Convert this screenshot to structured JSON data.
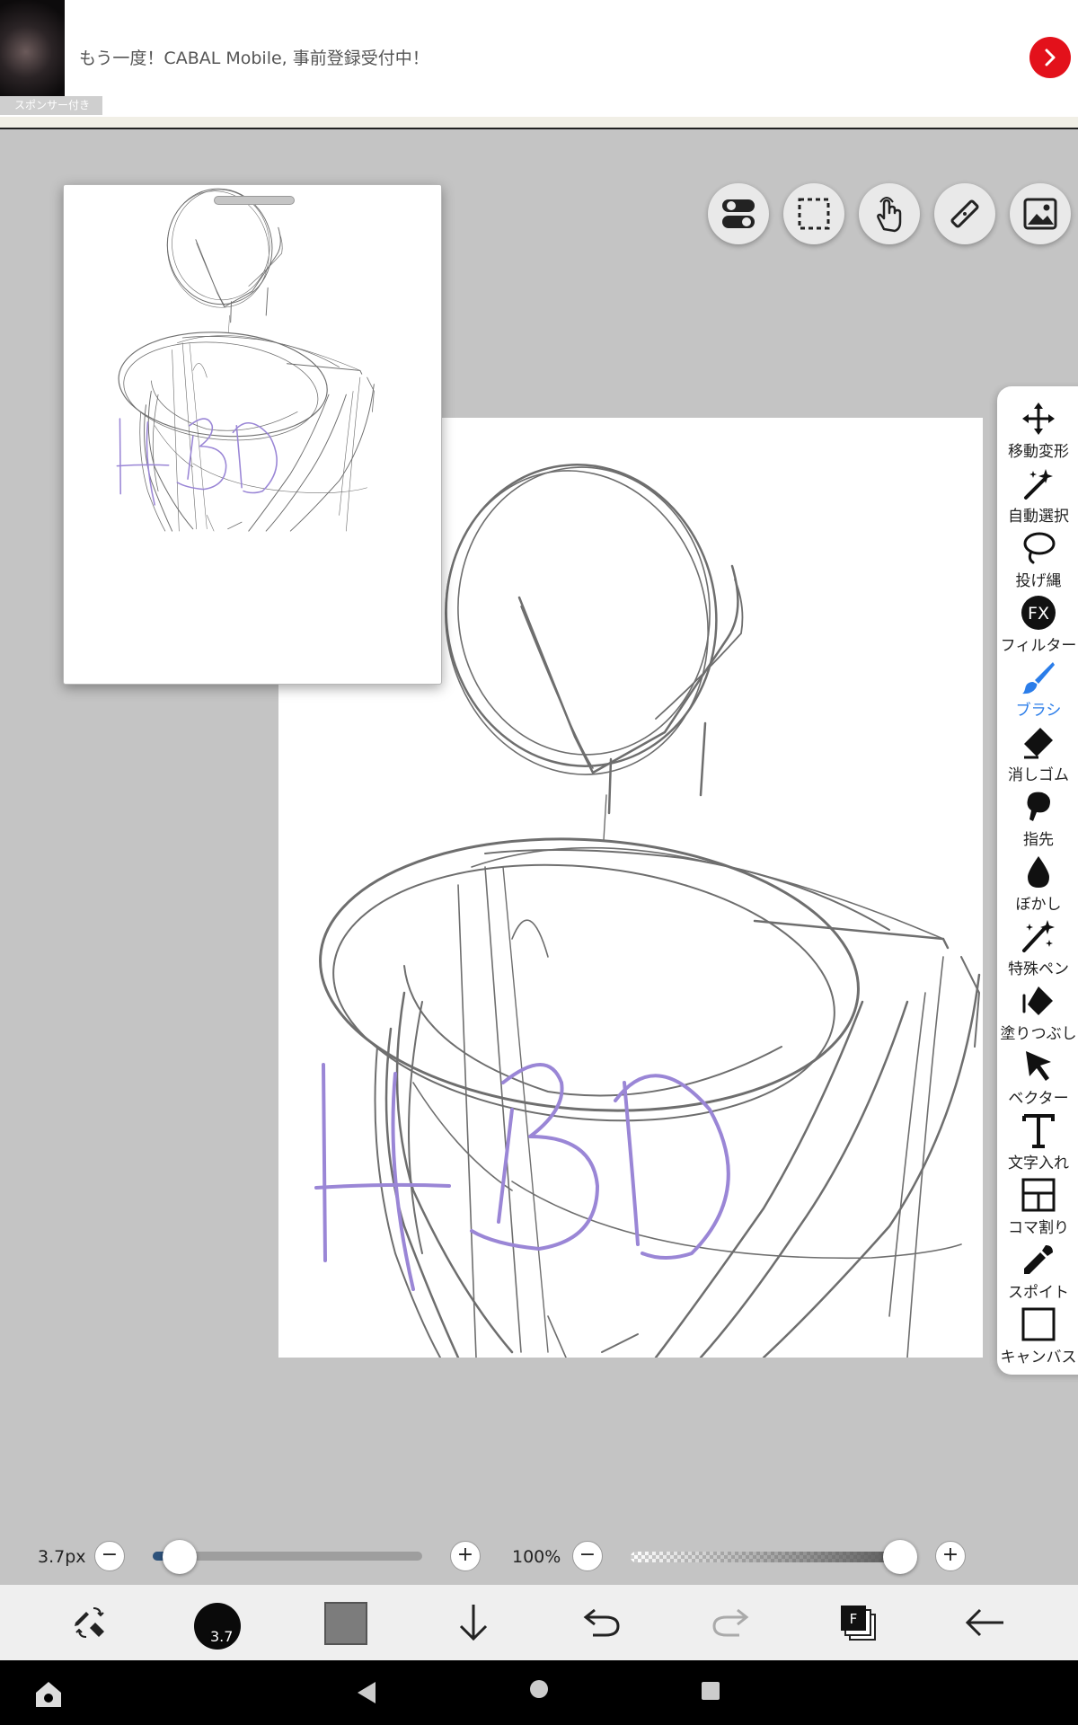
{
  "ad": {
    "text": "もう一度！CABAL Mobile, 事前登録受付中！",
    "sponsor_label": "スポンサー付き"
  },
  "top_buttons": [
    {
      "name": "toggle-icon"
    },
    {
      "name": "selection-icon"
    },
    {
      "name": "hand-icon"
    },
    {
      "name": "ruler-icon"
    },
    {
      "name": "image-icon"
    }
  ],
  "toolbar": {
    "items": [
      {
        "label": "移動変形",
        "icon": "move-icon"
      },
      {
        "label": "自動選択",
        "icon": "magic-wand-icon"
      },
      {
        "label": "投げ縄",
        "icon": "lasso-icon"
      },
      {
        "label": "フィルター",
        "icon": "fx-icon"
      },
      {
        "label": "ブラシ",
        "icon": "brush-icon",
        "active": true
      },
      {
        "label": "消しゴム",
        "icon": "eraser-icon"
      },
      {
        "label": "指先",
        "icon": "finger-icon"
      },
      {
        "label": "ぼかし",
        "icon": "blur-icon"
      },
      {
        "label": "特殊ペン",
        "icon": "special-pen-icon"
      },
      {
        "label": "塗りつぶし",
        "icon": "fill-icon"
      },
      {
        "label": "ベクター",
        "icon": "vector-icon"
      },
      {
        "label": "文字入れ",
        "icon": "text-icon"
      },
      {
        "label": "コマ割り",
        "icon": "frame-divider-icon"
      },
      {
        "label": "スポイト",
        "icon": "eyedropper-icon"
      },
      {
        "label": "キャンバス",
        "icon": "canvas-icon"
      }
    ],
    "active_color": "#2b7de9"
  },
  "sliders": {
    "size_label": "3.7px",
    "size_fraction": 0.1,
    "opacity_label": "100%",
    "opacity_fraction": 1.0
  },
  "bottom_bar": {
    "brush_size_badge": "3.7",
    "color": "#7c7c7c",
    "layer_label": "F"
  },
  "canvas": {
    "text_color": "#9a86d6",
    "sketch_color": "#6e6e6e"
  }
}
